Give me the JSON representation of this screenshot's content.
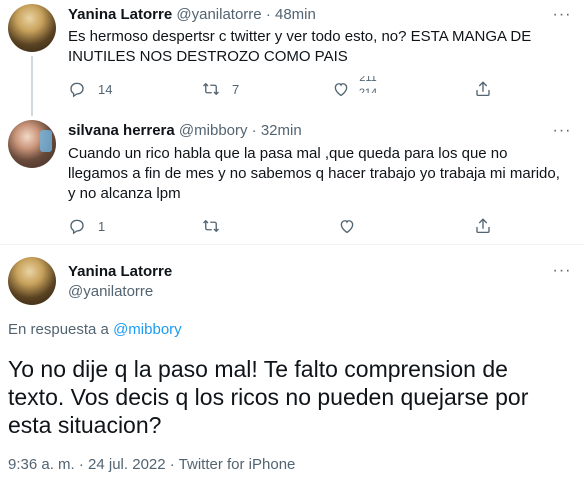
{
  "tweets": [
    {
      "name": "Yanina Latorre",
      "handle": "@yanilatorre",
      "separator": "·",
      "time": "48min",
      "text": "Es hermoso despertsr c twitter y ver todo esto, no? ESTA MANGA DE INUTILES NOS DESTROZO COMO PAIS",
      "replies": "14",
      "retweets": "7",
      "likes_scroll_top": "211",
      "likes_scroll_bottom": "214"
    },
    {
      "name": "silvana herrera",
      "handle": "@mibbory",
      "separator": "·",
      "time": "32min",
      "text": "Cuando un rico habla que la pasa mal ,que queda para los que no llegamos a fin de mes y no sabemos q hacer trabajo yo trabaja mi marido,  y no alcanza lpm",
      "replies": "1",
      "retweets": "",
      "likes": ""
    }
  ],
  "main_tweet": {
    "name": "Yanina Latorre",
    "handle": "@yanilatorre",
    "reply_prefix": "En respuesta a ",
    "reply_mention": "@mibbory",
    "text": "Yo no dije q la paso mal! Te falto comprension de texto. Vos decis q los ricos no pueden quejarse por esta situacion?",
    "date": "9:36 a. m. · 24 jul. 2022 · Twitter for iPhone"
  },
  "icons": {
    "more": "more-icon",
    "reply": "reply-icon",
    "retweet": "retweet-icon",
    "like": "like-icon",
    "share": "share-icon"
  },
  "colors": {
    "text": "#0f1419",
    "secondary": "#536471",
    "link": "#1d9bf0",
    "divider": "#eff3f4",
    "thread_line": "#cfd9de"
  }
}
